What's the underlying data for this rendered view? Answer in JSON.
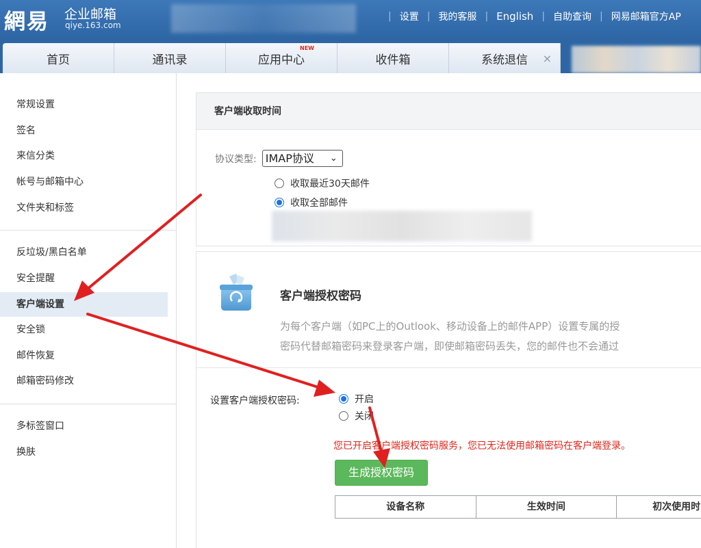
{
  "header": {
    "logo": "網易",
    "product": "企业邮箱",
    "domain": "qiye.163.com",
    "links": [
      "设置",
      "我的客服",
      "English",
      "自助查询",
      "网易邮箱官方AP"
    ]
  },
  "tabs": [
    {
      "label": "首页"
    },
    {
      "label": "通讯录"
    },
    {
      "label": "应用中心",
      "badge": "NEW"
    },
    {
      "label": "收件箱"
    },
    {
      "label": "系统退信",
      "close": "×"
    }
  ],
  "sidebar": {
    "groups": [
      [
        "常规设置",
        "签名",
        "来信分类",
        "帐号与邮箱中心",
        "文件夹和标签"
      ],
      [
        "反垃圾/黑白名单",
        "安全提醒",
        "客户端设置",
        "安全锁",
        "邮件恢复",
        "邮箱密码修改"
      ],
      [
        "多标签窗口",
        "换肤"
      ]
    ],
    "active": "客户端设置"
  },
  "client_fetch": {
    "title": "客户端收取时间",
    "protocol_label": "协议类型:",
    "protocol_value": "IMAP协议",
    "options": [
      {
        "label": "收取最近30天邮件",
        "checked": false
      },
      {
        "label": "收取全部邮件",
        "checked": true
      }
    ]
  },
  "auth": {
    "icon": "recycle-box-icon",
    "title": "客户端授权密码",
    "desc_line1": "为每个客户端（如PC上的Outlook、移动设备上的邮件APP）设置专属的授",
    "desc_line2": "密码代替邮箱密码来登录客户端，即使邮箱密码丢失，您的邮件也不会通过",
    "setting_label": "设置客户端授权密码:",
    "options": [
      {
        "label": "开启",
        "checked": true
      },
      {
        "label": "关闭",
        "checked": false
      }
    ],
    "warning": "您已开启客户端授权密码服务，您已无法使用邮箱密码在客户端登录。",
    "generate_button": "生成授权密码",
    "table_headers": [
      "设备名称",
      "生效时间",
      "初次使用时"
    ]
  },
  "colors": {
    "header_bg": "#2e66a5",
    "active_item_bg": "#e3ebf5",
    "warning": "#e0261b",
    "button_green": "#5cb85c",
    "arrow": "#e02020"
  }
}
